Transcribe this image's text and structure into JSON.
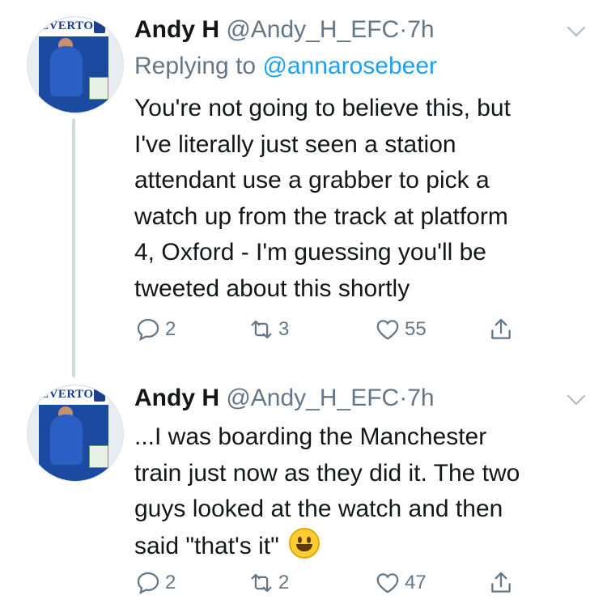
{
  "tweets": [
    {
      "avatar": {
        "banner_text": "EVERTON"
      },
      "name": "Andy H",
      "handle": "@Andy_H_EFC",
      "separator": "·",
      "time": "7h",
      "replying_prefix": "Replying to ",
      "replying_handle": "@annarosebeer",
      "text": "You're not going to believe this, but\nI've literally just seen a station\nattendant use a grabber to pick a\nwatch up from the track at platform\n4, Oxford - I'm guessing you'll be\ntweeted about this shortly",
      "replies": "2",
      "retweets": "3",
      "likes": "55"
    },
    {
      "avatar": {
        "banner_text": "EVERTON"
      },
      "name": "Andy H",
      "handle": "@Andy_H_EFC",
      "separator": "·",
      "time": "7h",
      "text": "...I was boarding the Manchester\ntrain just now as they did it. The two\nguys looked at the watch and then\nsaid \"that's it\" ",
      "emoji": "grinning-face",
      "replies": "2",
      "retweets": "2",
      "likes": "47"
    }
  ],
  "colors": {
    "text": "#14171a",
    "secondary": "#657786",
    "link": "#1da1f2",
    "thread_line": "#cfd9de"
  }
}
